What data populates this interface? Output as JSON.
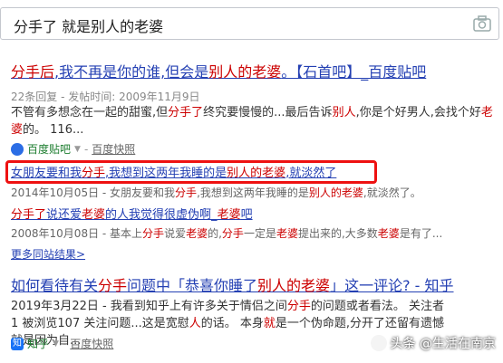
{
  "search": {
    "query": "分手了 就是别人的老婆"
  },
  "results": [
    {
      "title_html": "<em>分手后</em>,我不再是你的谁,但会是<em>别人的老婆</em>。【石首吧】_百度贴吧",
      "meta": "22条回复 - 发帖时间: 2009年11月9日",
      "abstract_html": "不管有多想念在一起的甜蜜,但<em>分手了</em>终究要慢慢的...最后告诉<em>别人</em>,你是个好男人,会找个好<em>老婆</em>的。 116...",
      "source": "百度贴吧",
      "snapshot": "百度快照",
      "sub_items": [
        {
          "title_html": "女朋友要和我<em>分手</em>,我想到这两年我睡的是<em>别人的老婆</em>,就淡然了",
          "meta_html": "2014年10月05日 - 女朋友要和我<em>分手</em>,我想到这两年我睡的是<em>别人的老婆</em>,就淡然了。"
        },
        {
          "title_html": "<em>分手了</em>说还爱<em>老婆</em>的人我觉得很虚伪啊_<em>老婆</em>吧",
          "meta_html": "2008年10月08日 - 基本上<em>分手</em>说爱<em>老婆</em>的,<em>分手</em>一定是<em>老婆</em>提出来的,大多数<em>老婆</em>是有了..."
        }
      ],
      "more": "更多同站结果>"
    },
    {
      "title_html": "如何看待有关<em>分手</em>问题中「恭喜你睡了<em>别人的老婆</em>」这一评论? - 知乎",
      "abstract_html": "2019年3月22日 - 我看到知乎上有许多关于情侣之间<em>分手</em>的问题或者看法。 关注者1 被浏览107 关注问题...这是宽慰<em>人</em>的话。 本身<em>就</em>是一个伪命题,分开了还留有遗憾就是因为自...",
      "source": "知乎",
      "snapshot": "百度快照"
    }
  ],
  "watermark": "头条 @生活在南京",
  "colors": {
    "link": "#2440b3",
    "highlight": "#cc0000",
    "source_green": "#1e7e30",
    "box_red": "#ee1111"
  }
}
